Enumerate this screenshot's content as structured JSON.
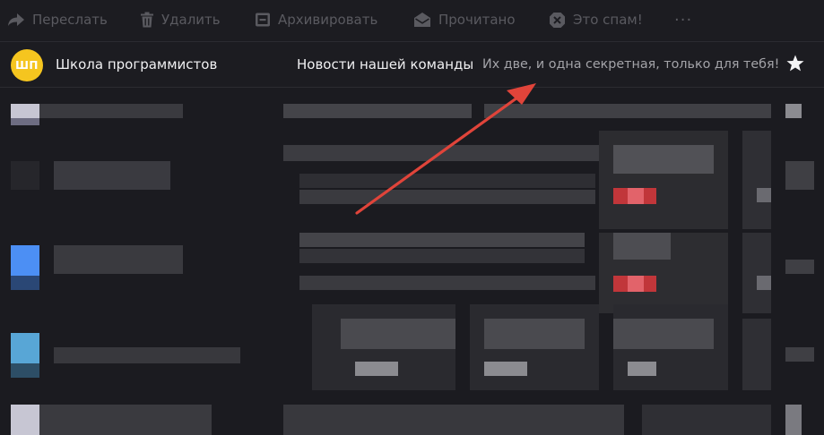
{
  "toolbar": {
    "forward_label": "Переслать",
    "forward_icon": "forward-arrow-icon",
    "delete_label": "Удалить",
    "delete_icon": "trash-icon",
    "archive_label": "Архивировать",
    "archive_icon": "archive-box-icon",
    "read_label": "Прочитано",
    "read_icon": "open-envelope-icon",
    "spam_label": "Это спам!",
    "spam_icon": "spam-shield-icon",
    "more_label": "···",
    "text_color": "#5a5a60"
  },
  "message": {
    "avatar_initials": "ШП",
    "avatar_color": "#f5c51f",
    "sender": "Школа программистов",
    "subject": "Новости нашей команды",
    "snippet": "Их две, и одна секретная, только для тебя!",
    "starred": false
  },
  "annotation": {
    "type": "arrow",
    "color": "#e0443a"
  },
  "theme": {
    "background": "#1c1c21",
    "divider": "#2b2b31"
  }
}
